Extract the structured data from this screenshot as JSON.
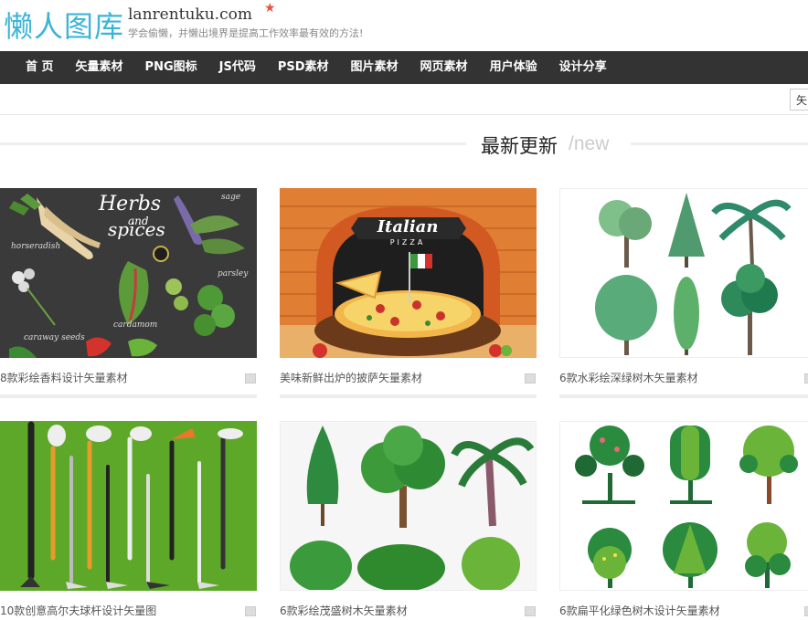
{
  "header": {
    "logo": "懒人图库",
    "domain": "lanrentuku.com",
    "slogan": "学会偷懒，并懒出境界是提高工作效率最有效的方法!"
  },
  "nav": {
    "items": [
      {
        "label": "首 页"
      },
      {
        "label": "矢量素材"
      },
      {
        "label": "PNG图标"
      },
      {
        "label": "JS代码"
      },
      {
        "label": "PSD素材"
      },
      {
        "label": "图片素材"
      },
      {
        "label": "网页素材"
      },
      {
        "label": "用户体验"
      },
      {
        "label": "设计分享"
      }
    ]
  },
  "search": {
    "value": "矢"
  },
  "section": {
    "title": "最新更新",
    "subtitle": "/new"
  },
  "thumb_texts": {
    "herbs_title_1": "Herbs",
    "herbs_title_2": "and",
    "herbs_title_3": "spices",
    "herbs_l1": "horseradish",
    "herbs_l2": "sage",
    "herbs_l3": "parsley",
    "herbs_l4": "cardamom",
    "herbs_l5": "caraway seeds",
    "pizza_title": "Italian",
    "pizza_sub": "PIZZA"
  },
  "cards": [
    {
      "caption": "8款彩绘香料设计矢量素材"
    },
    {
      "caption": "美味新鲜出炉的披萨矢量素材"
    },
    {
      "caption": "6款水彩绘深绿树木矢量素材"
    },
    {
      "caption": "10款创意高尔夫球杆设计矢量图"
    },
    {
      "caption": "6款彩绘茂盛树木矢量素材"
    },
    {
      "caption": "6款扁平化绿色树木设计矢量素材"
    }
  ]
}
